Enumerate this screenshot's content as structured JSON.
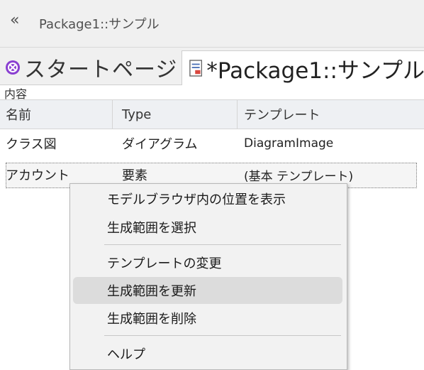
{
  "titlebar": {
    "collapse_glyph": "«",
    "title": "Package1::サンプル"
  },
  "tabs": {
    "start_label": "スタートページ",
    "start_icon": "start-page-icon",
    "active_label": "*Package1::サンプル",
    "active_icon": "document-icon"
  },
  "section_label": "内容",
  "table": {
    "headers": [
      "名前",
      "Type",
      "テンプレート"
    ],
    "rows": [
      [
        "クラス図",
        "ダイアグラム",
        "DiagramImage"
      ],
      [
        "アカウント",
        "要素",
        "(基本 テンプレート)"
      ]
    ]
  },
  "menu": {
    "items": [
      "モデルブラウザ内の位置を表示",
      "生成範囲を選択",
      "テンプレートの変更",
      "生成範囲を更新",
      "生成範囲を削除",
      "ヘルプ"
    ]
  }
}
